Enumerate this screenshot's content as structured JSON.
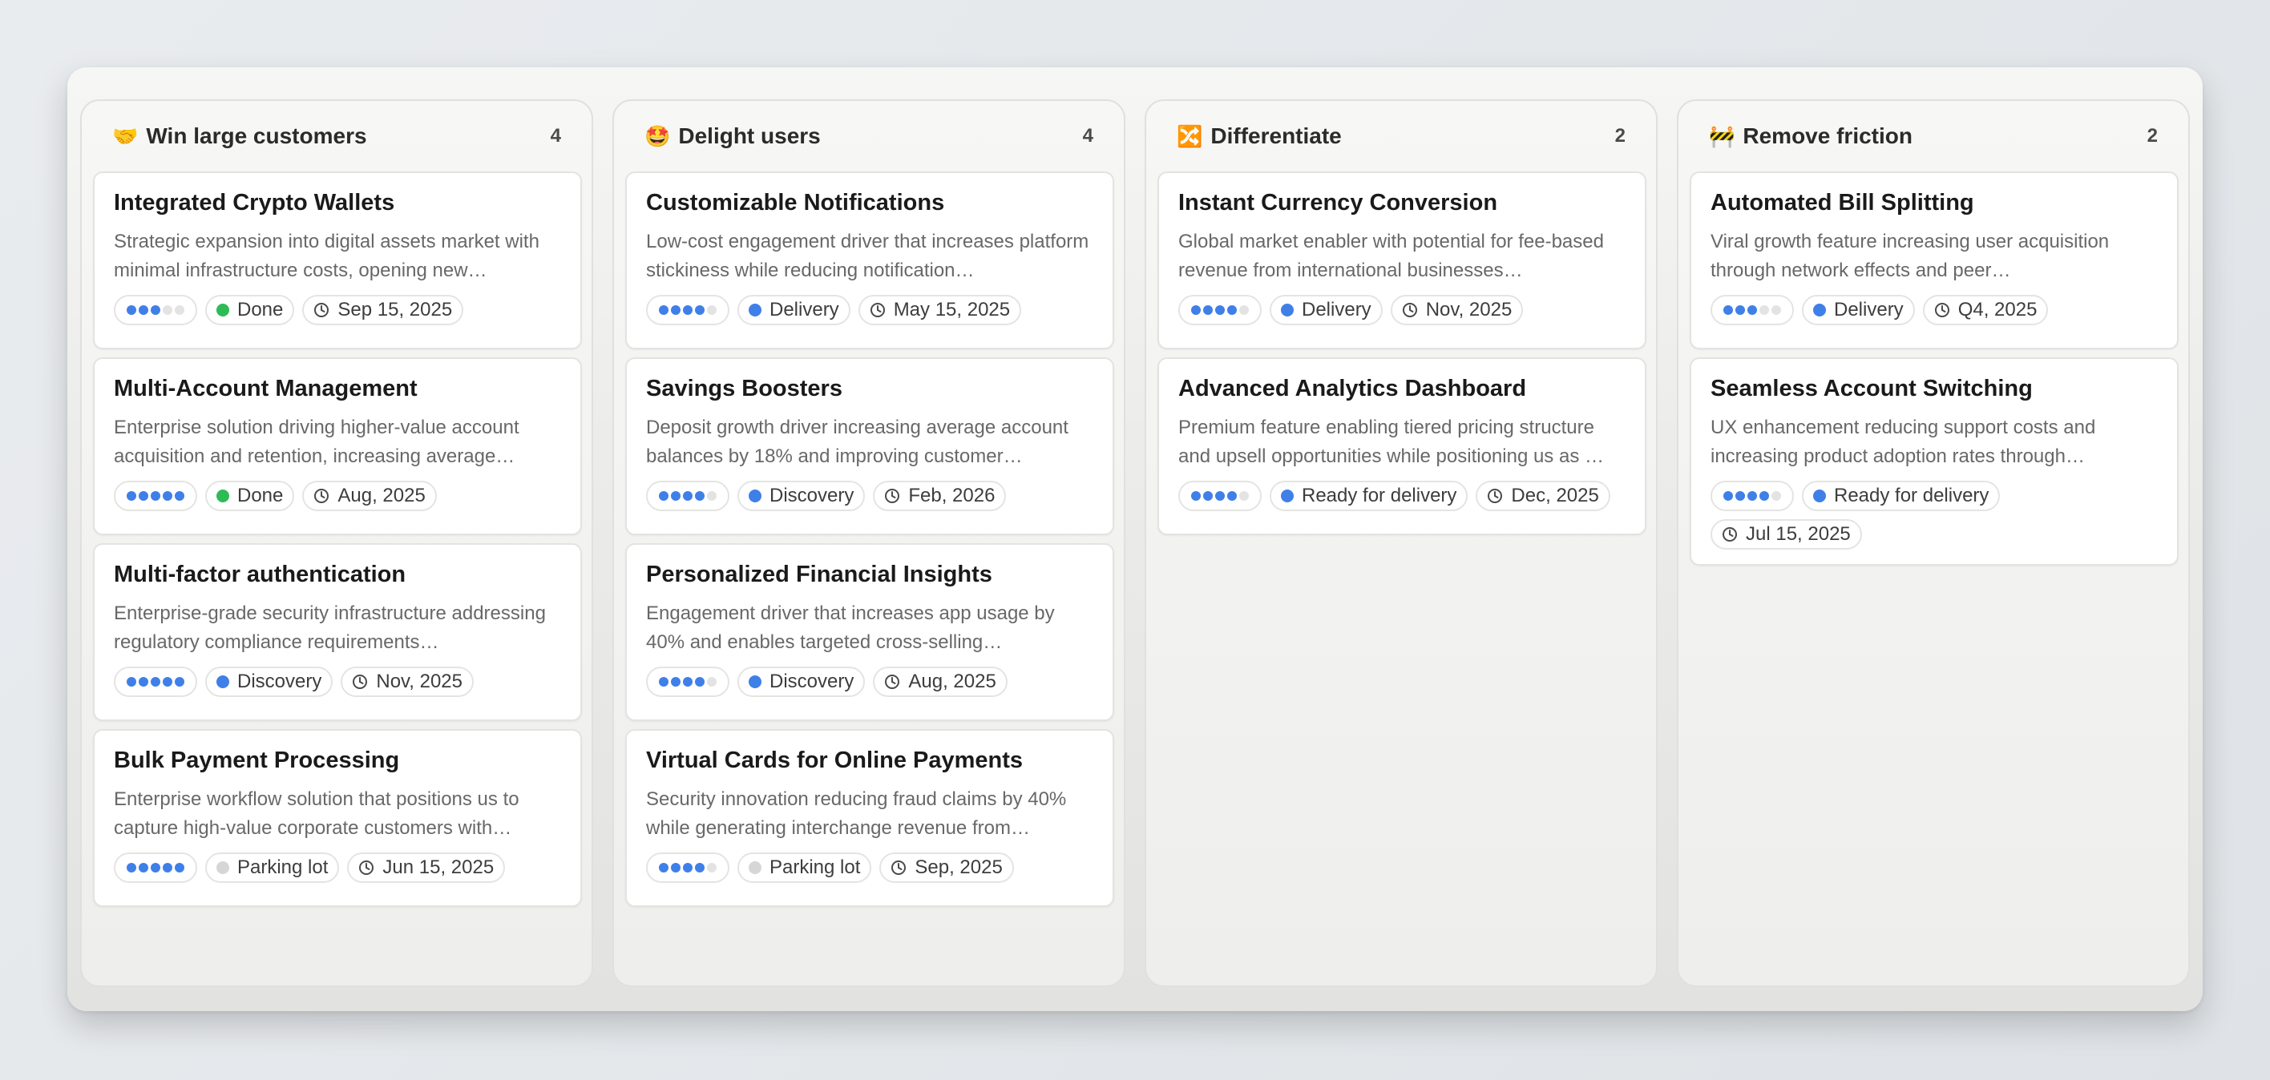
{
  "columns": [
    {
      "emoji": "🤝",
      "title": "Win large customers",
      "count": "4",
      "cards": [
        {
          "title": "Integrated Crypto Wallets",
          "desc": "Strategic expansion into digital assets market with minimal infrastructure costs, opening new…",
          "priority": 3,
          "status": "Done",
          "status_color": "#2dbb55",
          "date": "Sep 15, 2025"
        },
        {
          "title": "Multi-Account Management",
          "desc": "Enterprise solution driving higher-value account acquisition and retention, increasing average…",
          "priority": 5,
          "status": "Done",
          "status_color": "#2dbb55",
          "date": "Aug, 2025"
        },
        {
          "title": "Multi-factor authentication",
          "desc": "Enterprise-grade security infrastructure addressing regulatory compliance requirements…",
          "priority": 5,
          "status": "Discovery",
          "status_color": "#3f7fe8",
          "date": "Nov, 2025"
        },
        {
          "title": "Bulk Payment Processing",
          "desc": "Enterprise workflow solution that positions us to capture high-value corporate customers with…",
          "priority": 5,
          "status": "Parking lot",
          "status_color": "#d6d6d6",
          "date": "Jun 15, 2025"
        }
      ]
    },
    {
      "emoji": "🤩",
      "title": "Delight users",
      "count": "4",
      "cards": [
        {
          "title": "Customizable Notifications",
          "desc": "Low-cost engagement driver that increases platform stickiness while reducing notification…",
          "priority": 4,
          "status": "Delivery",
          "status_color": "#3f7fe8",
          "date": "May 15, 2025"
        },
        {
          "title": "Savings Boosters",
          "desc": "Deposit growth driver increasing average account balances by 18% and improving customer…",
          "priority": 4,
          "status": "Discovery",
          "status_color": "#3f7fe8",
          "date": "Feb, 2026"
        },
        {
          "title": "Personalized Financial Insights",
          "desc": "Engagement driver that increases app usage by 40% and enables targeted cross-selling…",
          "priority": 4,
          "status": "Discovery",
          "status_color": "#3f7fe8",
          "date": "Aug, 2025"
        },
        {
          "title": "Virtual Cards for Online Payments",
          "desc": "Security innovation reducing fraud claims by 40% while generating interchange revenue from…",
          "priority": 4,
          "status": "Parking lot",
          "status_color": "#d6d6d6",
          "date": "Sep, 2025"
        }
      ]
    },
    {
      "emoji": "🔀",
      "title": "Differentiate",
      "count": "2",
      "cards": [
        {
          "title": "Instant Currency Conversion",
          "desc": "Global market enabler with potential for fee-based revenue from international businesses…",
          "priority": 4,
          "status": "Delivery",
          "status_color": "#3f7fe8",
          "date": "Nov, 2025"
        },
        {
          "title": "Advanced Analytics Dashboard",
          "desc": "Premium feature enabling tiered pricing structure and upsell opportunities while positioning us as …",
          "priority": 4,
          "status": "Ready for delivery",
          "status_color": "#3f7fe8",
          "date": "Dec, 2025"
        }
      ]
    },
    {
      "emoji": "🚧",
      "title": "Remove friction",
      "count": "2",
      "cards": [
        {
          "title": "Automated Bill Splitting",
          "desc": "Viral growth feature increasing user acquisition through network effects and peer…",
          "priority": 3,
          "status": "Delivery",
          "status_color": "#3f7fe8",
          "date": "Q4, 2025"
        },
        {
          "title": "Seamless Account Switching",
          "desc": "UX enhancement reducing support costs and increasing product adoption rates through…",
          "priority": 4,
          "status": "Ready for delivery",
          "status_color": "#3f7fe8",
          "date": "Jul 15, 2025"
        }
      ]
    }
  ]
}
